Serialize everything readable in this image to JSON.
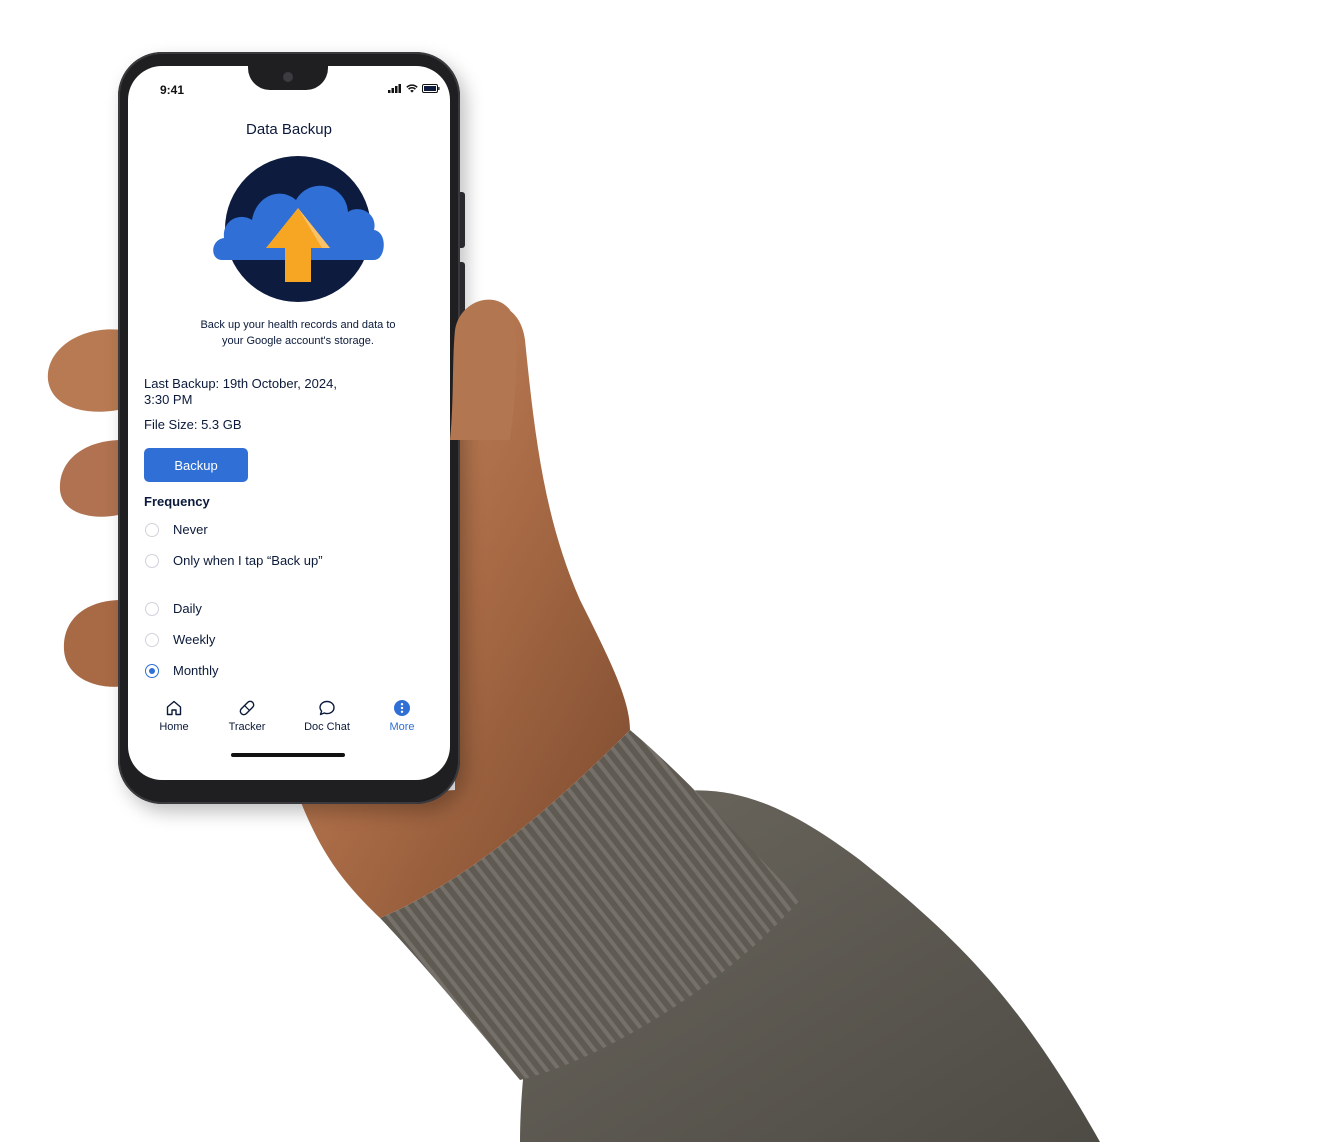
{
  "status_bar": {
    "time": "9:41"
  },
  "header": {
    "title": "Data Backup"
  },
  "hero": {
    "icon": "cloud-upload-icon",
    "colors": {
      "circle": "#0d1b3e",
      "cloud": "#2f6fd6",
      "arrow": "#f6a623"
    }
  },
  "description": "Back up your health records and data to your Google account's storage.",
  "last_backup": "Last Backup: 19th October, 2024, 3:30 PM",
  "file_size": "File Size: 5.3 GB",
  "backup_button": "Backup",
  "frequency": {
    "label": "Frequency",
    "options": [
      {
        "label": "Never",
        "selected": false
      },
      {
        "label": "Only when I tap “Back up”",
        "selected": false
      },
      {
        "label": "Daily",
        "selected": false
      },
      {
        "label": "Weekly",
        "selected": false
      },
      {
        "label": "Monthly",
        "selected": true
      }
    ]
  },
  "tabbar": {
    "items": [
      {
        "label": "Home",
        "icon": "home-icon",
        "active": false
      },
      {
        "label": "Tracker",
        "icon": "bandage-icon",
        "active": false
      },
      {
        "label": "Doc Chat",
        "icon": "chat-bubble-icon",
        "active": false
      },
      {
        "label": "More",
        "icon": "more-icon",
        "active": true
      }
    ]
  },
  "colors": {
    "accent": "#2f6fd6",
    "text": "#0b1a3a"
  }
}
